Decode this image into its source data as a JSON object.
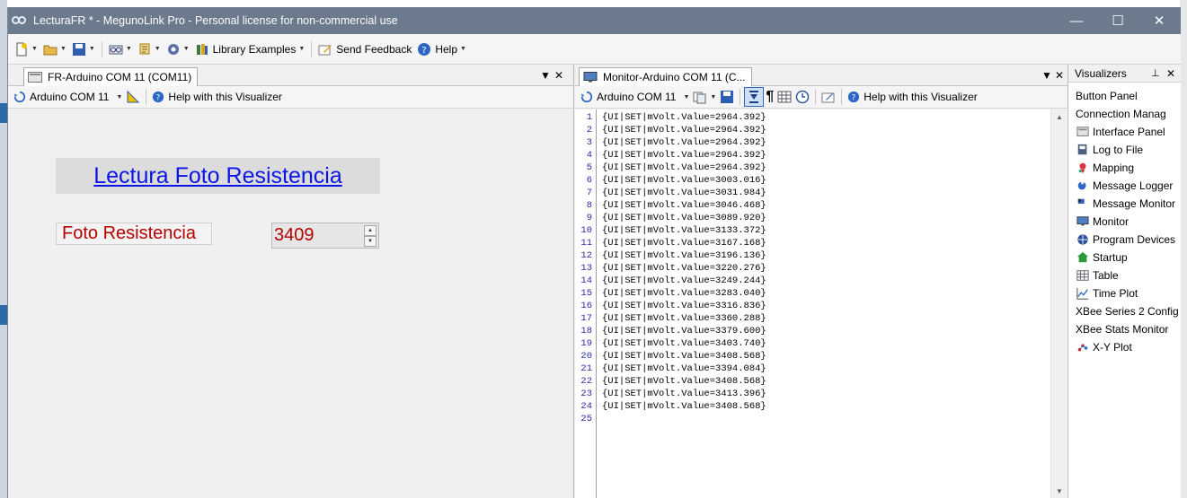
{
  "window": {
    "title": "LecturaFR * - MegunoLink Pro - Personal license for non-commercial use",
    "controls": {
      "minimize": "—",
      "maximize": "☐",
      "close": "✕"
    }
  },
  "toolbar": {
    "library_examples": "Library Examples",
    "send_feedback": "Send Feedback",
    "help": "Help"
  },
  "left_panel": {
    "tab_label": "FR-Arduino COM 11 (COM11)",
    "connection_label": "Arduino COM 11",
    "help_label": "Help with this Visualizer",
    "heading": "Lectura Foto Resistencia",
    "field_label": "Foto Resistencia",
    "field_value": "3409"
  },
  "monitor_panel": {
    "tab_label": "Monitor-Arduino COM 11 (C...",
    "connection_label": "Arduino COM 11",
    "help_label": "Help with this Visualizer",
    "lines": [
      {
        "n": "1",
        "text": "{UI|SET|mVolt.Value=2964.392}"
      },
      {
        "n": "2",
        "text": "{UI|SET|mVolt.Value=2964.392}"
      },
      {
        "n": "3",
        "text": "{UI|SET|mVolt.Value=2964.392}"
      },
      {
        "n": "4",
        "text": "{UI|SET|mVolt.Value=2964.392}"
      },
      {
        "n": "5",
        "text": "{UI|SET|mVolt.Value=2964.392}"
      },
      {
        "n": "6",
        "text": "{UI|SET|mVolt.Value=3003.016}"
      },
      {
        "n": "7",
        "text": "{UI|SET|mVolt.Value=3031.984}"
      },
      {
        "n": "8",
        "text": "{UI|SET|mVolt.Value=3046.468}"
      },
      {
        "n": "9",
        "text": "{UI|SET|mVolt.Value=3089.920}"
      },
      {
        "n": "10",
        "text": "{UI|SET|mVolt.Value=3133.372}"
      },
      {
        "n": "11",
        "text": "{UI|SET|mVolt.Value=3167.168}"
      },
      {
        "n": "12",
        "text": "{UI|SET|mVolt.Value=3196.136}"
      },
      {
        "n": "13",
        "text": "{UI|SET|mVolt.Value=3220.276}"
      },
      {
        "n": "14",
        "text": "{UI|SET|mVolt.Value=3249.244}"
      },
      {
        "n": "15",
        "text": "{UI|SET|mVolt.Value=3283.040}"
      },
      {
        "n": "16",
        "text": "{UI|SET|mVolt.Value=3316.836}"
      },
      {
        "n": "17",
        "text": "{UI|SET|mVolt.Value=3360.288}"
      },
      {
        "n": "18",
        "text": "{UI|SET|mVolt.Value=3379.600}"
      },
      {
        "n": "19",
        "text": "{UI|SET|mVolt.Value=3403.740}"
      },
      {
        "n": "20",
        "text": "{UI|SET|mVolt.Value=3408.568}"
      },
      {
        "n": "21",
        "text": "{UI|SET|mVolt.Value=3394.084}"
      },
      {
        "n": "22",
        "text": "{UI|SET|mVolt.Value=3408.568}"
      },
      {
        "n": "23",
        "text": "{UI|SET|mVolt.Value=3413.396}"
      },
      {
        "n": "24",
        "text": "{UI|SET|mVolt.Value=3408.568}"
      },
      {
        "n": "25",
        "text": ""
      }
    ]
  },
  "visualizers": {
    "title": "Visualizers",
    "items": [
      {
        "label": "Button Panel",
        "icon": "none"
      },
      {
        "label": "Connection Manag",
        "icon": "none"
      },
      {
        "label": "Interface Panel",
        "icon": "interface-panel-icon"
      },
      {
        "label": "Log to File",
        "icon": "log-to-file-icon"
      },
      {
        "label": "Mapping",
        "icon": "mapping-icon"
      },
      {
        "label": "Message Logger",
        "icon": "message-logger-icon"
      },
      {
        "label": "Message Monitor",
        "icon": "message-monitor-icon"
      },
      {
        "label": "Monitor",
        "icon": "monitor-icon"
      },
      {
        "label": "Program Devices",
        "icon": "program-devices-icon"
      },
      {
        "label": "Startup",
        "icon": "startup-icon"
      },
      {
        "label": "Table",
        "icon": "table-icon"
      },
      {
        "label": "Time Plot",
        "icon": "time-plot-icon"
      },
      {
        "label": "XBee Series 2 Config",
        "icon": "none"
      },
      {
        "label": "XBee Stats Monitor",
        "icon": "none"
      },
      {
        "label": "X-Y Plot",
        "icon": "xy-plot-icon"
      }
    ]
  },
  "colors": {
    "titlebar": "#6b7a8c",
    "heading_link": "#0a15e6",
    "value_red": "#b30000",
    "line_numbers": "#2b2bb0"
  }
}
